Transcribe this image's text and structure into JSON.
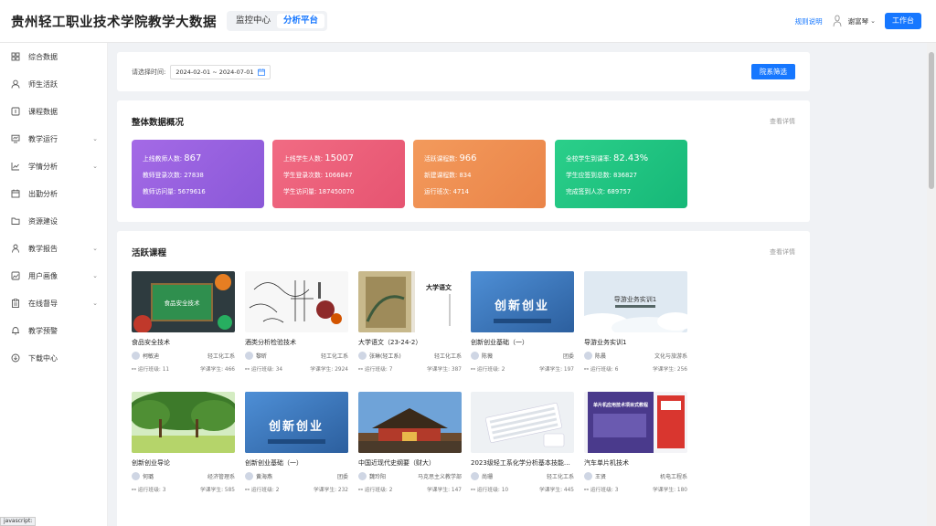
{
  "header": {
    "brand": "贵州轻工职业技术学院教学大数据",
    "mode_monitor": "监控中心",
    "mode_analysis": "分析平台",
    "rule_link": "规则说明",
    "user_name": "谢富琴",
    "work_button": "工作台"
  },
  "sidebar": {
    "items": [
      {
        "label": "综合数据",
        "icon": "grid-icon",
        "expandable": false
      },
      {
        "label": "师生活跃",
        "icon": "user-icon",
        "expandable": false
      },
      {
        "label": "课程数据",
        "icon": "book-icon",
        "expandable": false
      },
      {
        "label": "教学运行",
        "icon": "monitor-icon",
        "expandable": true
      },
      {
        "label": "学情分析",
        "icon": "line-chart-icon",
        "expandable": true
      },
      {
        "label": "出勤分析",
        "icon": "calendar-icon",
        "expandable": false
      },
      {
        "label": "资源建设",
        "icon": "folder-icon",
        "expandable": false
      },
      {
        "label": "教学报告",
        "icon": "person-icon",
        "expandable": true
      },
      {
        "label": "用户画像",
        "icon": "picture-icon",
        "expandable": true
      },
      {
        "label": "在线督导",
        "icon": "clipboard-icon",
        "expandable": true
      },
      {
        "label": "教学预警",
        "icon": "bell-icon",
        "expandable": false
      },
      {
        "label": "下载中心",
        "icon": "download-icon",
        "expandable": false
      }
    ]
  },
  "filter": {
    "label": "请选择时间:",
    "date_range": "2024-02-01 ~ 2024-07-01",
    "dept_button": "院系筛选"
  },
  "overview": {
    "title": "整体数据概况",
    "detail_link": "查看详情",
    "cards": [
      {
        "color_from": "#a46ae6",
        "color_to": "#8a58d8",
        "rows": [
          {
            "label": "上线教师人数: ",
            "value": "867"
          },
          {
            "label": "教师登录次数: ",
            "value": "27838"
          },
          {
            "label": "教师访问量: ",
            "value": "5679616"
          }
        ]
      },
      {
        "color_from": "#f16b83",
        "color_to": "#e65471",
        "rows": [
          {
            "label": "上线学生人数: ",
            "value": "15007"
          },
          {
            "label": "学生登录次数: ",
            "value": "1066847"
          },
          {
            "label": "学生访问量: ",
            "value": "187450070"
          }
        ]
      },
      {
        "color_from": "#f39a5c",
        "color_to": "#ea8448",
        "rows": [
          {
            "label": "活跃课程数: ",
            "value": "966"
          },
          {
            "label": "新建课程数: ",
            "value": "834"
          },
          {
            "label": "运行班次: ",
            "value": "4714"
          }
        ]
      },
      {
        "color_from": "#2bcf8a",
        "color_to": "#16b878",
        "rows": [
          {
            "label": "全校学生到课率: ",
            "value": "82.43%"
          },
          {
            "label": "学生应签到总数: ",
            "value": "836827"
          },
          {
            "label": "完成签到人次: ",
            "value": "689757"
          }
        ]
      }
    ]
  },
  "courses": {
    "title": "活跃课程",
    "detail_link": "查看详情",
    "run_label": "运行班级: ",
    "learn_label": "学课学生: ",
    "items": [
      {
        "title": "食品安全技术",
        "teacher": "柯敏迪",
        "dept": "轻工化工系",
        "classes": "11",
        "students": "466",
        "thumb": "green-board",
        "caption": "食品安全技术"
      },
      {
        "title": "酒类分析检验技术",
        "teacher": "黎昕",
        "dept": "轻工化工系",
        "classes": "34",
        "students": "2924",
        "thumb": "wine-art",
        "caption": ""
      },
      {
        "title": "大学语文（23-24-2）",
        "teacher": "张琳(轻工系)",
        "dept": "轻工化工系",
        "classes": "7",
        "students": "387",
        "thumb": "chinese-book",
        "caption": "大学语文"
      },
      {
        "title": "创新创业基础（一）",
        "teacher": "陈薇",
        "dept": "团委",
        "classes": "2",
        "students": "197",
        "thumb": "blue-banner",
        "caption": "创新创业"
      },
      {
        "title": "导游业务实训1",
        "teacher": "陈晨",
        "dept": "文化与旅游系",
        "classes": "6",
        "students": "256",
        "thumb": "cloud-title",
        "caption": "导游业务实训1"
      },
      {
        "title": "创新创业导论",
        "teacher": "何璐",
        "dept": "经济管理系",
        "classes": "3",
        "students": "585",
        "thumb": "green-trees",
        "caption": ""
      },
      {
        "title": "创新创业基础（一）",
        "teacher": "黄海燕",
        "dept": "团委",
        "classes": "2",
        "students": "232",
        "thumb": "blue-banner",
        "caption": "创新创业"
      },
      {
        "title": "中国近现代史纲要（财大）",
        "teacher": "魏玲阳",
        "dept": "马克思主义教学部",
        "classes": "2",
        "students": "147",
        "thumb": "palace",
        "caption": ""
      },
      {
        "title": "2023级轻工系化学分析基本技能训练（甲）",
        "teacher": "尚珊",
        "dept": "轻工化工系",
        "classes": "10",
        "students": "445",
        "thumb": "keyboard",
        "caption": ""
      },
      {
        "title": "汽车单片机技术",
        "teacher": "王贤",
        "dept": "机电工程系",
        "classes": "3",
        "students": "180",
        "thumb": "purple-book",
        "caption": "单片机应用技术项目式教程"
      }
    ]
  },
  "status_hint": "javascript:"
}
